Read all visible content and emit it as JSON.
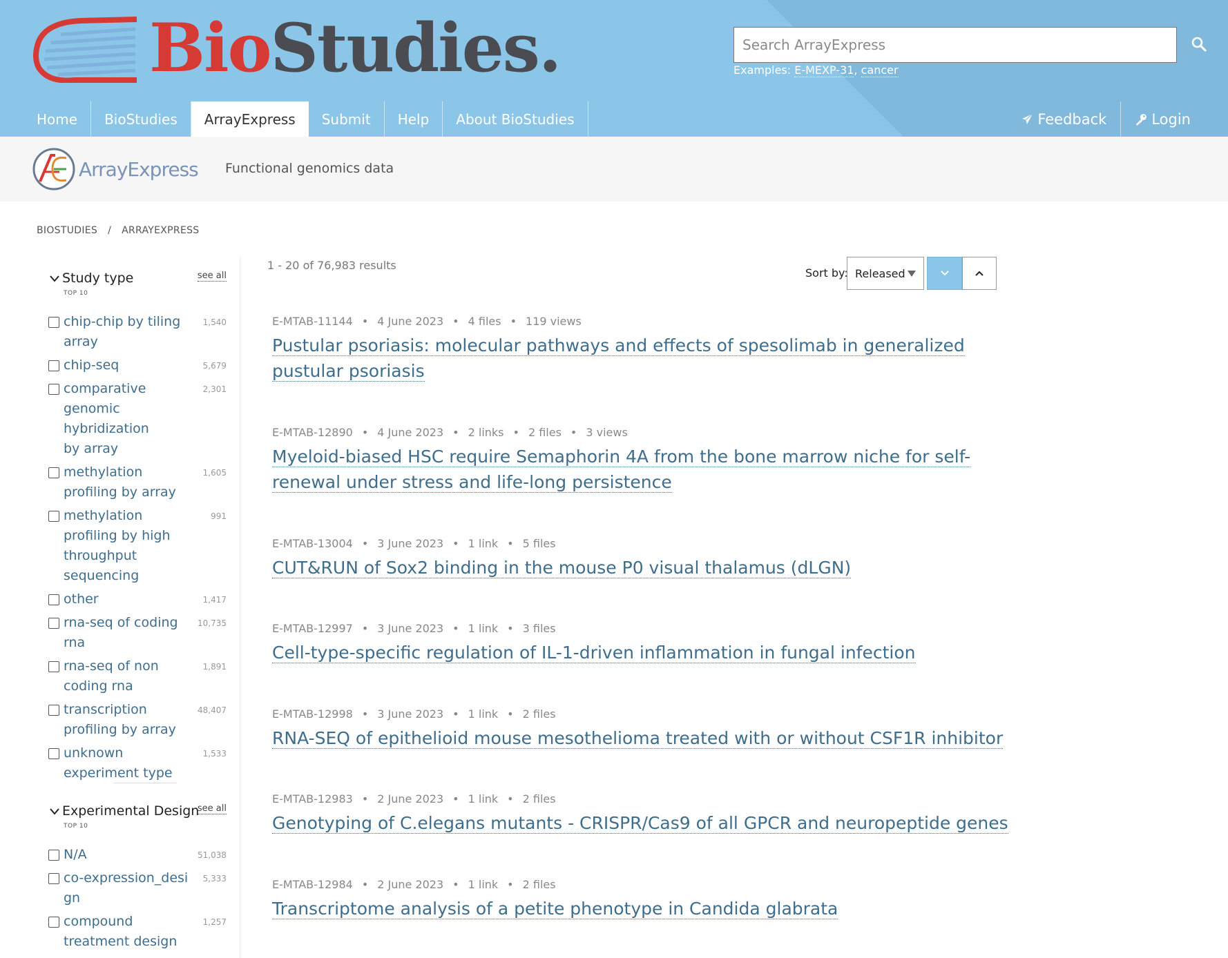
{
  "header": {
    "logo_bio": "Bio",
    "logo_studies": "Studies.",
    "search_placeholder": "Search ArrayExpress",
    "examples_label": "Examples: ",
    "example_1": "E-MEXP-31",
    "example_sep": ", ",
    "example_2": "cancer",
    "nav": [
      "Home",
      "BioStudies",
      "ArrayExpress",
      "Submit",
      "Help",
      "About BioStudies"
    ],
    "active_nav": "ArrayExpress",
    "feedback_label": "Feedback",
    "login_label": "Login",
    "colors": {
      "masthead": "#8bc5e8",
      "logo_red": "#d63a35",
      "logo_grey": "#4a4c52",
      "link": "#3f6d8c"
    }
  },
  "subheader": {
    "logo_text": "ArrayExpress",
    "tagline": "Functional genomics data"
  },
  "breadcrumb": {
    "items": [
      "BIOSTUDIES",
      "ARRAYEXPRESS"
    ],
    "separator": "/"
  },
  "sidebar": {
    "facets": [
      {
        "title": "Study type",
        "see_all": "see all",
        "subtitle": "TOP 10",
        "items": [
          {
            "label": "chip-chip by tiling array",
            "count": "1,540"
          },
          {
            "label": "chip-seq",
            "count": "5,679"
          },
          {
            "label": "comparative genomic hybridization by array",
            "count": "2,301"
          },
          {
            "label": "methylation profiling by array",
            "count": "1,605"
          },
          {
            "label": "methylation profiling by high throughput sequencing",
            "count": "991"
          },
          {
            "label": "other",
            "count": "1,417"
          },
          {
            "label": "rna-seq of coding rna",
            "count": "10,735"
          },
          {
            "label": "rna-seq of non coding rna",
            "count": "1,891"
          },
          {
            "label": "transcription profiling by array",
            "count": "48,407"
          },
          {
            "label": "unknown experiment type",
            "count": "1,533"
          }
        ]
      },
      {
        "title": "Experimental Design",
        "see_all": "see all",
        "subtitle": "TOP 10",
        "items": [
          {
            "label": "N/A",
            "count": "51,038"
          },
          {
            "label": "co-expression_design",
            "count": "5,333"
          },
          {
            "label": "compound treatment design",
            "count": "1,257"
          }
        ]
      }
    ]
  },
  "results": {
    "count_text": "1 - 20 of 76,983 results",
    "sort_label": "Sort by:",
    "sort_value": "Released",
    "items": [
      {
        "accession": "E-MTAB-11144",
        "date": "4 June 2023",
        "info": [
          "4 files",
          "119 views"
        ],
        "title": "Pustular psoriasis: molecular pathways and effects of spesolimab in generalized pustular psoriasis"
      },
      {
        "accession": "E-MTAB-12890",
        "date": "4 June 2023",
        "info": [
          "2 links",
          "2 files",
          "3 views"
        ],
        "title": "Myeloid-biased HSC require Semaphorin 4A from the bone marrow niche for self-renewal under stress and life-long persistence"
      },
      {
        "accession": "E-MTAB-13004",
        "date": "3 June 2023",
        "info": [
          "1 link",
          "5 files"
        ],
        "title": "CUT&RUN of Sox2 binding in the mouse P0 visual thalamus (dLGN)"
      },
      {
        "accession": "E-MTAB-12997",
        "date": "3 June 2023",
        "info": [
          "1 link",
          "3 files"
        ],
        "title": "Cell-type-specific regulation of IL-1-driven inflammation in fungal infection"
      },
      {
        "accession": "E-MTAB-12998",
        "date": "3 June 2023",
        "info": [
          "1 link",
          "2 files"
        ],
        "title": "RNA-SEQ of epithelioid mouse mesothelioma treated with or without CSF1R inhibitor"
      },
      {
        "accession": "E-MTAB-12983",
        "date": "2 June 2023",
        "info": [
          "1 link",
          "2 files"
        ],
        "title": "Genotyping of C.elegans mutants - CRISPR/Cas9 of all GPCR and neuropeptide genes"
      },
      {
        "accession": "E-MTAB-12984",
        "date": "2 June 2023",
        "info": [
          "1 link",
          "2 files"
        ],
        "title": "Transcriptome analysis of a petite phenotype in Candida glabrata"
      }
    ]
  }
}
